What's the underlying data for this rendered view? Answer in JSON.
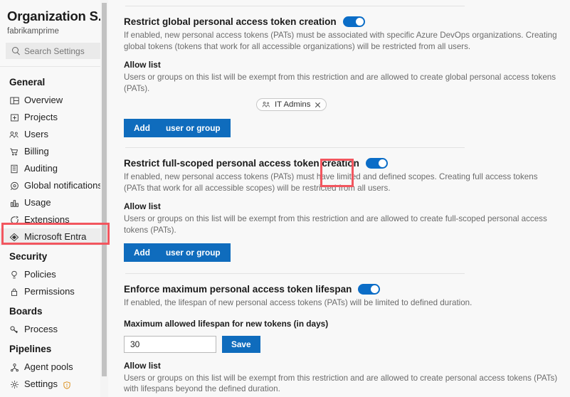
{
  "sidebar": {
    "title": "Organization S...",
    "subtitle": "fabrikamprime",
    "search": {
      "placeholder": "Search Settings",
      "icon": "search-icon"
    },
    "groups": [
      {
        "label": "General",
        "items": [
          {
            "label": "Overview",
            "icon": "overview-icon"
          },
          {
            "label": "Projects",
            "icon": "projects-icon"
          },
          {
            "label": "Users",
            "icon": "users-icon"
          },
          {
            "label": "Billing",
            "icon": "billing-cart-icon"
          },
          {
            "label": "Auditing",
            "icon": "auditing-list-icon"
          },
          {
            "label": "Global notifications",
            "icon": "notifications-icon"
          },
          {
            "label": "Usage",
            "icon": "usage-chart-icon"
          },
          {
            "label": "Extensions",
            "icon": "extensions-icon"
          },
          {
            "label": "Microsoft Entra",
            "icon": "entra-diamond-icon",
            "active": true
          }
        ]
      },
      {
        "label": "Security",
        "items": [
          {
            "label": "Policies",
            "icon": "policies-shield-icon"
          },
          {
            "label": "Permissions",
            "icon": "permissions-lock-icon"
          }
        ]
      },
      {
        "label": "Boards",
        "items": [
          {
            "label": "Process",
            "icon": "process-icon"
          }
        ]
      },
      {
        "label": "Pipelines",
        "items": [
          {
            "label": "Agent pools",
            "icon": "agent-pools-icon"
          },
          {
            "label": "Settings",
            "icon": "gear-icon",
            "badge": "warning-shield-badge"
          }
        ]
      }
    ]
  },
  "main": {
    "sections": [
      {
        "title": "Restrict global personal access token creation",
        "toggle_on": true,
        "description": "If enabled, new personal access tokens (PATs) must be associated with specific Azure DevOps organizations. Creating global tokens (tokens that work for all accessible organizations) will be restricted from all users.",
        "allow_list_title": "Allow list",
        "allow_list_desc": "Users or groups on this list will be exempt from this restriction and are allowed to create global personal access tokens (PATs).",
        "chips": [
          {
            "label": "IT Admins",
            "icon": "group-icon",
            "remove": "close-icon"
          }
        ],
        "add_button": {
          "label_primary": "Add",
          "label_secondary": "user or group"
        }
      },
      {
        "title": "Restrict full-scoped personal access token creation",
        "toggle_on": true,
        "description": "If enabled, new personal access tokens (PATs) must have limited and defined scopes. Creating full access tokens (PATs that work for all accessible scopes) will be restricted from all users.",
        "allow_list_title": "Allow list",
        "allow_list_desc": "Users or groups on this list will be exempt from this restriction and are allowed to create full-scoped personal access tokens (PATs).",
        "chips": [],
        "add_button": {
          "label_primary": "Add",
          "label_secondary": "user or group"
        }
      },
      {
        "title": "Enforce maximum personal access token lifespan",
        "toggle_on": true,
        "description": "If enabled, the lifespan of new personal access tokens (PATs) will be limited to defined duration.",
        "field_label": "Maximum allowed lifespan for new tokens (in days)",
        "field_value": "30",
        "save_label": "Save",
        "allow_list_title": "Allow list",
        "allow_list_desc": "Users or groups on this list will be exempt from this restriction and are allowed to create personal access tokens (PATs) with lifespans beyond the defined duration."
      }
    ]
  },
  "colors": {
    "accent_blue": "#0f6cbd",
    "toggle_blue": "#0b6dc7",
    "highlight_red": "#f2565f",
    "page_bg": "#f8f8f8",
    "muted_text": "#6b6b6b"
  }
}
